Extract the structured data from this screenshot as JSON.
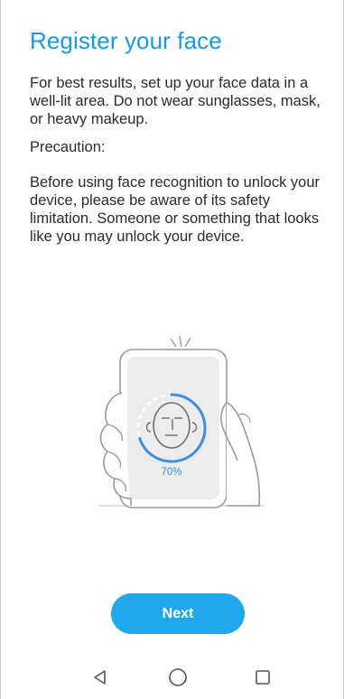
{
  "page": {
    "title": "Register your face",
    "intro": "For best results, set up your face data in a well-lit area. Do not wear sunglasses, mask, or heavy makeup.",
    "precaution_heading": "Precaution:",
    "precaution_text": "Before using face recognition to unlock your device, please be aware of its safety limitation. Someone or something that looks like you may unlock your device."
  },
  "illustration": {
    "progress_label": "70%",
    "progress": 0.7
  },
  "actions": {
    "next_label": "Next"
  },
  "nav": {
    "back_icon": "back-triangle-icon",
    "home_icon": "home-circle-icon",
    "recents_icon": "recents-square-icon"
  },
  "colors": {
    "accent": "#1a9be0",
    "button": "#20a7ee"
  }
}
